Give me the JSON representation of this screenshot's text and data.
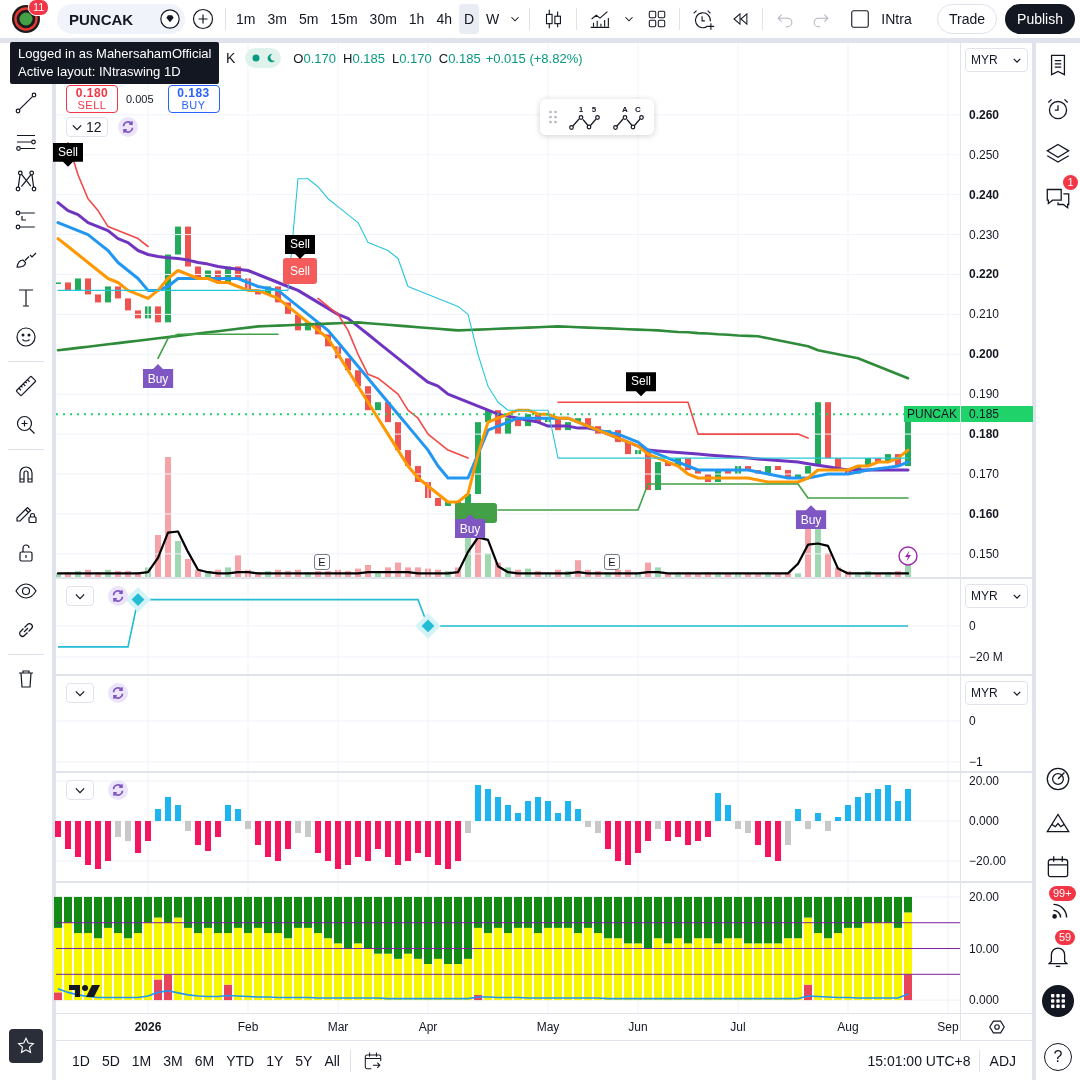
{
  "top_bar": {
    "avatar_badge": "11",
    "symbol": "PUNCAK",
    "intervals": [
      {
        "label": "1m",
        "selected": false
      },
      {
        "label": "3m",
        "selected": false
      },
      {
        "label": "5m",
        "selected": false
      },
      {
        "label": "15m",
        "selected": false
      },
      {
        "label": "30m",
        "selected": false
      },
      {
        "label": "1h",
        "selected": false
      },
      {
        "label": "4h",
        "selected": false
      },
      {
        "label": "D",
        "selected": true
      },
      {
        "label": "W",
        "selected": false
      }
    ],
    "undo": {
      "disabled": true
    },
    "redo": {
      "disabled": true
    },
    "layout_name": "INtra",
    "trade": "Trade",
    "publish": "Publish"
  },
  "tooltip": {
    "lines": [
      "Logged in as MahersahamOfficial",
      "Active layout: INtraswing 1D"
    ]
  },
  "right_sidebar": {
    "chat_badge": "1",
    "feed_badge": "99+",
    "notifications_badge": "59",
    "help": "?"
  },
  "main_pane": {
    "legend": {
      "symbol_tail": "K",
      "values": [
        {
          "key": "O",
          "value": "0.170"
        },
        {
          "key": "H",
          "value": "0.185"
        },
        {
          "key": "L",
          "value": "0.170"
        },
        {
          "key": "C",
          "value": "0.185"
        }
      ],
      "change": "+0.015 (+8.82%)"
    },
    "trade_box": {
      "sell_price": "0.180",
      "sell": "SELL",
      "spread": "0.005",
      "buy_price": "0.183",
      "buy": "BUY"
    },
    "interval_control": "12",
    "currency": "MYR",
    "price_tag": {
      "symbol": "PUNCAK",
      "price": "0.185"
    },
    "signals": [
      {
        "kind": "sell",
        "label": "Sell"
      },
      {
        "kind": "buy",
        "label": "Buy"
      },
      {
        "kind": "sell_box",
        "label": "Sell"
      },
      {
        "kind": "sell",
        "label": "Sell"
      },
      {
        "kind": "earnings",
        "label": "E"
      },
      {
        "kind": "buy_box"
      },
      {
        "kind": "buy",
        "label": "Buy"
      },
      {
        "kind": "earnings",
        "label": "E"
      },
      {
        "kind": "sell",
        "label": "Sell"
      },
      {
        "kind": "buy",
        "label": "Buy"
      },
      {
        "kind": "event"
      }
    ],
    "chart_data": {
      "type": "line",
      "grid": true,
      "ylim": [
        0.1442,
        0.278
      ],
      "yticks": [
        {
          "value": 0.26,
          "label": "0.260"
        },
        {
          "value": 0.25,
          "label": "0.250"
        },
        {
          "value": 0.24,
          "label": "0.240"
        },
        {
          "value": 0.23,
          "label": "0.230"
        },
        {
          "value": 0.22,
          "label": "0.220"
        },
        {
          "value": 0.21,
          "label": "0.210"
        },
        {
          "value": 0.2,
          "label": "0.200"
        },
        {
          "value": 0.19,
          "label": "0.190"
        },
        {
          "value": 0.18,
          "label": "0.180"
        },
        {
          "value": 0.17,
          "label": "0.170"
        },
        {
          "value": 0.16,
          "label": "0.160"
        },
        {
          "value": 0.15,
          "label": "0.150"
        }
      ],
      "ref_lines": [
        {
          "axis": "y",
          "value": 0.185,
          "color": "#1fd26a"
        }
      ],
      "series": [
        {
          "color": "#6f35c0",
          "values": [
            0.238,
            0.236,
            0.235,
            0.233,
            0.232,
            0.231,
            0.229,
            0.228,
            0.226,
            0.225,
            0.2245,
            0.2242,
            0.224,
            0.2236,
            0.223,
            0.2226,
            0.222,
            0.2216,
            0.2213,
            0.221,
            0.22,
            0.219,
            0.218,
            0.217,
            0.216,
            0.2145,
            0.213,
            0.2115,
            0.21,
            0.209,
            0.207,
            0.205,
            0.203,
            0.201,
            0.199,
            0.197,
            0.195,
            0.193,
            0.192,
            0.19,
            0.189,
            0.188,
            0.187,
            0.186,
            0.185,
            0.1845,
            0.184,
            0.1835,
            0.183,
            0.182,
            0.182,
            0.182,
            0.1815,
            0.1815,
            0.181,
            0.18,
            0.179,
            0.178,
            0.177,
            0.176,
            0.1758,
            0.1756,
            0.1754,
            0.1752,
            0.175,
            0.1748,
            0.1746,
            0.1744,
            0.1742,
            0.174,
            0.1738,
            0.1736,
            0.1734,
            0.1732,
            0.173,
            0.1726,
            0.1722,
            0.1718,
            0.1714,
            0.171,
            0.171,
            0.171,
            0.171,
            0.171,
            0.171,
            0.171
          ]
        },
        {
          "color": "#2196f3",
          "values": [
            0.233,
            0.232,
            0.231,
            0.23,
            0.228,
            0.226,
            0.223,
            0.221,
            0.219,
            0.216,
            0.216,
            0.217,
            0.219,
            0.219,
            0.219,
            0.219,
            0.219,
            0.219,
            0.219,
            0.218,
            0.217,
            0.2165,
            0.216,
            0.214,
            0.212,
            0.21,
            0.208,
            0.206,
            0.203,
            0.2,
            0.197,
            0.194,
            0.191,
            0.188,
            0.185,
            0.182,
            0.179,
            0.176,
            0.172,
            0.169,
            0.169,
            0.169,
            0.175,
            0.181,
            0.182,
            0.183,
            0.184,
            0.184,
            0.184,
            0.184,
            0.184,
            0.184,
            0.183,
            0.182,
            0.181,
            0.1805,
            0.18,
            0.179,
            0.178,
            0.176,
            0.175,
            0.174,
            0.173,
            0.172,
            0.171,
            0.171,
            0.171,
            0.171,
            0.171,
            0.171,
            0.1705,
            0.17,
            0.1695,
            0.169,
            0.169,
            0.169,
            0.1695,
            0.17,
            0.17,
            0.17,
            0.1705,
            0.171,
            0.1713,
            0.1716,
            0.172,
            0.173
          ]
        },
        {
          "color": "#ff9800",
          "values": [
            0.229,
            0.227,
            0.225,
            0.223,
            0.221,
            0.219,
            0.218,
            0.216,
            0.215,
            0.214,
            0.216,
            0.219,
            0.221,
            0.22,
            0.219,
            0.219,
            0.218,
            0.218,
            0.217,
            0.216,
            0.216,
            0.215,
            0.214,
            0.212,
            0.21,
            0.208,
            0.206,
            0.204,
            0.2,
            0.196,
            0.192,
            0.188,
            0.184,
            0.18,
            0.176,
            0.172,
            0.169,
            0.167,
            0.165,
            0.163,
            0.163,
            0.165,
            0.175,
            0.183,
            0.184,
            0.185,
            0.186,
            0.186,
            0.185,
            0.185,
            0.184,
            0.184,
            0.183,
            0.182,
            0.181,
            0.18,
            0.179,
            0.178,
            0.177,
            0.175,
            0.174,
            0.173,
            0.172,
            0.17,
            0.169,
            0.169,
            0.169,
            0.169,
            0.169,
            0.169,
            0.1685,
            0.168,
            0.168,
            0.168,
            0.168,
            0.169,
            0.171,
            0.171,
            0.171,
            0.171,
            0.172,
            0.172,
            0.173,
            0.173,
            0.174,
            0.176
          ]
        },
        {
          "color": "#2e8b3a",
          "values": [
            0.201,
            0.2013,
            0.2016,
            0.2019,
            0.2022,
            0.2025,
            0.2028,
            0.2031,
            0.2034,
            0.2037,
            0.204,
            0.2043,
            0.2046,
            0.2049,
            0.2052,
            0.2055,
            0.2058,
            0.2061,
            0.2064,
            0.2067,
            0.207,
            0.2071,
            0.2072,
            0.2073,
            0.2074,
            0.2075,
            0.2076,
            0.2077,
            0.2078,
            0.2079,
            0.208,
            0.2078,
            0.2076,
            0.2074,
            0.2072,
            0.207,
            0.2068,
            0.2066,
            0.2064,
            0.2062,
            0.206,
            0.2061,
            0.2062,
            0.2063,
            0.2064,
            0.2065,
            0.2066,
            0.2067,
            0.2068,
            0.2069,
            0.207,
            0.2069,
            0.2068,
            0.2067,
            0.2066,
            0.2065,
            0.2064,
            0.2063,
            0.2062,
            0.2061,
            0.206,
            0.2058,
            0.2056,
            0.2055,
            0.2053,
            0.2052,
            0.205,
            0.2049,
            0.2047,
            0.2046,
            0.2045,
            0.204,
            0.2035,
            0.203,
            0.2025,
            0.202,
            0.201,
            0.2005,
            0.2,
            0.1995,
            0.199,
            0.198,
            0.197,
            0.196,
            0.195,
            0.194
          ]
        },
        {
          "color": "#f44848",
          "values": [
            null,
            0.253,
            0.245,
            0.239,
            0.236,
            0.232,
            0.231,
            0.23,
            0.229,
            0.227,
            null,
            null,
            null,
            null,
            null,
            null,
            null,
            null,
            null,
            null,
            null,
            null,
            null,
            null,
            null,
            null,
            0.214,
            0.212,
            0.21,
            0.206,
            0.2,
            0.195,
            0.194,
            0.192,
            0.19,
            0.186,
            0.184,
            0.18,
            0.178,
            0.176,
            0.175,
            0.174,
            null,
            null,
            null,
            null,
            null,
            null,
            null,
            null,
            0.188,
            0.188,
            0.188,
            0.188,
            0.188,
            0.188,
            0.188,
            0.188,
            0.188,
            0.188,
            0.188,
            0.188,
            0.188,
            0.188,
            0.18,
            0.18,
            0.18,
            0.18,
            0.18,
            0.18,
            0.18,
            0.18,
            0.18,
            0.18,
            0.18,
            0.179,
            null,
            null,
            null,
            null,
            null,
            null,
            null,
            null,
            null,
            null
          ]
        },
        {
          "color": "#43a047",
          "values": [
            null,
            null,
            null,
            null,
            null,
            null,
            null,
            null,
            null,
            null,
            0.199,
            0.204,
            0.205,
            0.205,
            0.205,
            0.205,
            0.205,
            0.205,
            0.205,
            0.205,
            0.205,
            0.205,
            0.205,
            null,
            null,
            null,
            null,
            null,
            null,
            null,
            null,
            null,
            null,
            null,
            null,
            null,
            null,
            null,
            null,
            null,
            null,
            null,
            null,
            null,
            0.161,
            0.161,
            0.161,
            0.161,
            0.161,
            0.161,
            0.161,
            0.161,
            0.161,
            0.161,
            0.161,
            0.161,
            0.161,
            0.161,
            0.161,
            0.1675,
            0.1675,
            0.1675,
            0.1675,
            0.1675,
            0.1675,
            0.1675,
            0.1675,
            0.1675,
            0.1675,
            0.1675,
            0.1675,
            0.1675,
            0.1675,
            0.1675,
            0.1675,
            0.164,
            0.164,
            0.164,
            0.164,
            0.164,
            0.164,
            0.164,
            0.164,
            0.164,
            0.164,
            0.164
          ]
        },
        {
          "color": "#26c6da",
          "values": [
            0.216,
            0.216,
            0.216,
            0.216,
            0.216,
            0.216,
            0.216,
            0.216,
            0.216,
            0.216,
            0.216,
            0.216,
            0.216,
            0.216,
            0.216,
            0.216,
            0.216,
            0.216,
            0.216,
            0.216,
            0.216,
            0.216,
            0.216,
            0.216,
            0.244,
            0.244,
            0.242,
            0.239,
            0.237,
            0.235,
            0.233,
            0.228,
            0.227,
            0.226,
            0.224,
            0.217,
            0.216,
            0.215,
            0.214,
            0.213,
            0.212,
            0.21,
            0.2,
            0.192,
            0.188,
            0.186,
            0.186,
            0.186,
            0.186,
            0.186,
            0.174,
            0.174,
            0.174,
            0.174,
            0.174,
            0.174,
            0.174,
            0.174,
            0.174,
            0.174,
            0.174,
            0.174,
            0.174,
            0.174,
            0.174,
            0.174,
            0.174,
            0.174,
            0.174,
            0.174,
            0.174,
            0.174,
            0.174,
            0.174,
            0.174,
            0.174,
            0.174,
            0.174,
            0.174,
            0.174,
            0.174,
            0.174,
            0.174,
            0.174,
            0.174,
            0.174
          ]
        },
        {
          "color": "#000000",
          "values": [
            0.1451,
            0.1451,
            0.1451,
            0.1451,
            0.1451,
            0.1451,
            0.1451,
            0.1451,
            0.1451,
            0.1454,
            0.149,
            0.1553,
            0.1556,
            0.1505,
            0.146,
            0.1454,
            0.1451,
            0.1451,
            0.1454,
            0.1454,
            0.1451,
            0.1451,
            0.1451,
            0.1451,
            0.1451,
            0.1451,
            0.1451,
            0.1451,
            0.1451,
            0.1451,
            0.1451,
            0.1454,
            0.1454,
            0.1454,
            0.1454,
            0.1454,
            0.1451,
            0.1451,
            0.1451,
            0.1451,
            0.1454,
            0.1505,
            0.1541,
            0.1535,
            0.1469,
            0.1454,
            0.1451,
            0.1451,
            0.1451,
            0.1451,
            0.1451,
            0.1451,
            0.1454,
            0.1451,
            0.1451,
            0.1451,
            0.1451,
            0.1451,
            0.1451,
            0.1454,
            0.1454,
            0.1451,
            0.1451,
            0.1451,
            0.1451,
            0.1451,
            0.1451,
            0.1451,
            0.1451,
            0.1451,
            0.1451,
            0.1451,
            0.1451,
            0.1451,
            0.1475,
            0.1523,
            0.1526,
            0.152,
            0.1463,
            0.1451,
            0.1451,
            0.1451,
            0.1451,
            0.1451,
            0.1451,
            0.1451
          ]
        }
      ]
    }
  },
  "floating_toolbar": {
    "tools": [
      {
        "marks": [
          "1",
          "5"
        ]
      },
      {
        "marks": [
          "A",
          "C"
        ]
      }
    ]
  },
  "panes": [
    {
      "currency": "MYR",
      "controls_shown": true,
      "chart_data": {
        "type": "line",
        "grid": true,
        "ylim": [
          -31,
          30.3
        ],
        "yticks": [
          {
            "value": 0,
            "label": "0"
          },
          {
            "value": -20,
            "label": "−20 M"
          }
        ],
        "series": [
          {
            "color": "#22bcd4",
            "values": [
              -13.5,
              -13.5,
              -13.5,
              -13.5,
              -13.5,
              -13.5,
              -13.5,
              -13.5,
              17,
              17,
              17,
              17,
              17,
              17,
              17,
              17,
              17,
              17,
              17,
              17,
              17,
              17,
              17,
              17,
              17,
              17,
              17,
              17,
              17,
              17,
              17,
              17,
              17,
              17,
              17,
              17,
              17,
              0,
              0,
              0,
              0,
              0,
              0,
              0,
              0,
              0,
              0,
              0,
              0,
              0,
              0,
              0,
              0,
              0,
              0,
              0,
              0,
              0,
              0,
              0,
              0,
              0,
              0,
              0,
              0,
              0,
              0,
              0,
              0,
              0,
              0,
              0,
              0,
              0,
              0,
              0,
              0,
              0,
              0,
              0,
              0,
              0,
              0,
              0,
              0,
              0
            ]
          },
          {
            "type": "scatter",
            "color": "#22bcd4",
            "values": [
              null,
              null,
              null,
              null,
              null,
              null,
              null,
              null,
              17,
              null,
              null,
              null,
              null,
              null,
              null,
              null,
              null,
              null,
              null,
              null,
              null,
              null,
              null,
              null,
              null,
              null,
              null,
              null,
              null,
              null,
              null,
              null,
              null,
              null,
              null,
              null,
              null,
              0,
              null,
              null,
              null,
              null,
              null,
              null,
              null,
              null,
              null,
              null,
              null,
              null,
              null,
              null,
              null,
              null,
              null,
              null,
              null,
              null,
              null,
              null,
              null,
              null,
              null,
              null,
              null,
              null,
              null,
              null,
              null,
              null,
              null,
              null,
              null,
              null,
              null,
              null,
              null,
              null,
              null,
              null,
              null,
              null,
              null,
              null,
              null,
              null
            ]
          }
        ]
      }
    },
    {
      "currency": "MYR",
      "controls_shown": true,
      "chart_data": {
        "type": "line",
        "grid": true,
        "categories": [
          null,
          null,
          null,
          null,
          null,
          null,
          null,
          null,
          null,
          null,
          null,
          null,
          null,
          null,
          null,
          null,
          null,
          null,
          null,
          null,
          null,
          null,
          null,
          null,
          null,
          null,
          null,
          null,
          null,
          null,
          null,
          null,
          null,
          null,
          null,
          null,
          null,
          null,
          null,
          null,
          null,
          null,
          null,
          null,
          null,
          null,
          null,
          null,
          null,
          null,
          null,
          null,
          null,
          null,
          null,
          null,
          null,
          null,
          null,
          null,
          null,
          null,
          null,
          null,
          null,
          null,
          null,
          null,
          null,
          null,
          null,
          null,
          null,
          null,
          null,
          null,
          null,
          null,
          null,
          null,
          null,
          null,
          null,
          null,
          null,
          null
        ],
        "ylim": [
          -1.22,
          1.1
        ],
        "yticks": [
          {
            "value": 0,
            "label": "0"
          },
          {
            "value": -1,
            "label": "−1"
          }
        ]
      }
    },
    {
      "controls_shown": true,
      "chart_data": {
        "type": "bar",
        "grid": true,
        "ylim": [
          -30,
          24
        ],
        "yticks": [
          {
            "value": 20,
            "label": "20.00"
          },
          {
            "value": 0,
            "label": "0.000"
          },
          {
            "value": -20,
            "label": "−20.00"
          }
        ],
        "series": [
          {
            "color": "#1eb4f0",
            "values": [
              null,
              null,
              null,
              null,
              null,
              null,
              null,
              null,
              null,
              null,
              6,
              12,
              8,
              null,
              null,
              null,
              null,
              8,
              6,
              null,
              null,
              null,
              null,
              null,
              null,
              null,
              null,
              null,
              null,
              null,
              null,
              null,
              null,
              null,
              null,
              null,
              null,
              null,
              null,
              null,
              null,
              null,
              18,
              16,
              12,
              8,
              4,
              10,
              12,
              10,
              4,
              10,
              6,
              null,
              null,
              null,
              null,
              null,
              null,
              null,
              null,
              null,
              null,
              null,
              null,
              null,
              14,
              8,
              null,
              null,
              null,
              null,
              null,
              null,
              6,
              null,
              4,
              null,
              2,
              8,
              12,
              14,
              16,
              18,
              10,
              16
            ]
          },
          {
            "color": "#f5145e",
            "values": [
              -8,
              -14,
              -18,
              -22,
              -24,
              -20,
              null,
              null,
              -16,
              -10,
              null,
              null,
              null,
              null,
              -12,
              -15,
              -8,
              null,
              null,
              null,
              -12,
              -18,
              -20,
              -14,
              null,
              null,
              -16,
              -20,
              -24,
              -22,
              -18,
              -20,
              -14,
              -18,
              -22,
              -20,
              -16,
              -18,
              -22,
              -24,
              -20,
              null,
              null,
              null,
              null,
              null,
              null,
              null,
              null,
              null,
              null,
              null,
              null,
              null,
              null,
              -14,
              -20,
              -22,
              -16,
              -10,
              null,
              -10,
              -8,
              -12,
              -10,
              -8,
              null,
              null,
              null,
              null,
              -12,
              -18,
              -20,
              null,
              null,
              null,
              null,
              null,
              null,
              null,
              null,
              null,
              null,
              null,
              null,
              null
            ]
          },
          {
            "color": "#c8c8c8",
            "values": [
              null,
              null,
              null,
              null,
              null,
              null,
              -8,
              -10,
              null,
              null,
              null,
              null,
              null,
              -5,
              null,
              null,
              null,
              null,
              null,
              -4,
              null,
              null,
              null,
              null,
              -6,
              -8,
              null,
              null,
              null,
              null,
              null,
              null,
              null,
              null,
              null,
              null,
              null,
              null,
              null,
              null,
              null,
              -6,
              null,
              null,
              null,
              null,
              null,
              null,
              null,
              null,
              null,
              null,
              null,
              -3,
              -6,
              null,
              null,
              null,
              null,
              null,
              -4,
              null,
              null,
              null,
              null,
              null,
              null,
              null,
              -4,
              -6,
              null,
              null,
              null,
              -12,
              null,
              -4,
              null,
              -5,
              null,
              null,
              null,
              null,
              null,
              null,
              null,
              null
            ]
          }
        ]
      }
    },
    {
      "controls_shown": false,
      "chart_data": {
        "type": "bar",
        "stacked": true,
        "grid": true,
        "categories": [
          null,
          null,
          null,
          null,
          null,
          null,
          null,
          null,
          null,
          "2026",
          null,
          null,
          null,
          null,
          null,
          null,
          null,
          null,
          null,
          "Feb",
          null,
          null,
          null,
          null,
          null,
          null,
          null,
          null,
          "Mar",
          null,
          null,
          null,
          null,
          null,
          null,
          null,
          null,
          "Apr",
          null,
          null,
          null,
          null,
          null,
          null,
          null,
          null,
          null,
          null,
          null,
          "May",
          null,
          null,
          null,
          null,
          null,
          null,
          null,
          null,
          "Jun",
          null,
          null,
          null,
          null,
          null,
          null,
          null,
          null,
          null,
          "Jul",
          null,
          null,
          null,
          null,
          null,
          null,
          null,
          null,
          null,
          null,
          "Aug",
          null,
          null,
          null,
          null,
          null,
          null,
          null,
          null,
          null,
          "Sep"
        ],
        "ylim": [
          -2.5,
          22.7
        ],
        "yticks": [
          {
            "value": 20,
            "label": "20.00"
          },
          {
            "value": 10,
            "label": "10.00"
          },
          {
            "value": 0,
            "label": "0.000"
          }
        ],
        "ref_lines": [
          {
            "axis": "y",
            "value": 15,
            "color": "#7b1fa2"
          },
          {
            "axis": "y",
            "value": 10,
            "color": "#7b1fa2"
          },
          {
            "axis": "y",
            "value": 5,
            "color": "#7b1fa2"
          }
        ],
        "series": [
          {
            "color": "#e8445a",
            "values": [
              1.5,
              null,
              null,
              null,
              null,
              null,
              null,
              null,
              null,
              null,
              4,
              5,
              null,
              null,
              null,
              null,
              null,
              3,
              null,
              null,
              null,
              null,
              null,
              null,
              null,
              null,
              null,
              null,
              null,
              null,
              null,
              null,
              null,
              null,
              null,
              null,
              null,
              null,
              null,
              null,
              null,
              null,
              1,
              null,
              null,
              null,
              null,
              null,
              null,
              null,
              null,
              null,
              null,
              null,
              null,
              null,
              null,
              null,
              null,
              null,
              null,
              null,
              null,
              null,
              null,
              null,
              null,
              null,
              null,
              null,
              null,
              null,
              null,
              null,
              null,
              3,
              null,
              null,
              null,
              null,
              null,
              null,
              null,
              null,
              null,
              5,
              null,
              null,
              null,
              null
            ]
          },
          {
            "color": "#f7f700",
            "values": [
              12.5,
              15,
              13,
              13,
              12,
              14,
              13,
              12,
              13,
              15,
              12,
              10,
              16,
              14,
              13,
              14,
              13,
              10,
              14,
              13,
              14,
              13,
              13,
              12,
              14,
              14,
              13,
              12,
              11,
              10,
              11,
              10,
              9,
              9,
              8,
              9,
              8,
              7,
              8,
              7,
              7,
              8,
              13,
              13,
              14,
              13,
              14,
              14,
              13,
              14,
              14,
              14,
              13,
              14,
              13,
              12,
              12,
              11,
              11,
              10,
              12,
              11,
              12,
              11,
              12,
              12,
              11,
              12,
              12,
              11,
              11,
              11,
              11,
              12,
              12,
              13,
              13,
              12,
              13,
              14,
              14,
              15,
              15,
              15,
              14,
              12,
              null,
              null,
              null,
              null
            ]
          },
          {
            "color": "#138a13",
            "values": [
              6,
              5,
              7,
              7,
              8,
              6,
              7,
              8,
              7,
              5,
              4,
              5,
              4,
              6,
              7,
              6,
              7,
              7,
              6,
              7,
              6,
              7,
              7,
              8,
              6,
              6,
              7,
              8,
              9,
              10,
              9,
              10,
              11,
              11,
              12,
              11,
              12,
              13,
              12,
              13,
              13,
              12,
              6,
              7,
              6,
              7,
              6,
              6,
              7,
              6,
              6,
              6,
              7,
              6,
              7,
              8,
              8,
              9,
              9,
              10,
              8,
              9,
              8,
              9,
              8,
              8,
              9,
              8,
              8,
              9,
              9,
              9,
              9,
              8,
              8,
              4,
              7,
              8,
              7,
              6,
              6,
              5,
              5,
              5,
              6,
              3,
              null,
              null,
              null,
              null
            ]
          },
          {
            "type": "line",
            "color": "#2196f3",
            "values": [
              2.2,
              1.5,
              1,
              0.7,
              0.5,
              0.5,
              0.5,
              0.5,
              0.5,
              0.8,
              1.5,
              1.8,
              1.4,
              1,
              0.8,
              0.7,
              0.7,
              0.9,
              0.8,
              0.7,
              0.6,
              0.6,
              0.5,
              0.5,
              0.5,
              0.5,
              0.4,
              0.4,
              0.4,
              0.4,
              0.4,
              0.4,
              0.4,
              0.3,
              0.3,
              0.3,
              0.3,
              0.3,
              0.3,
              0.3,
              0.3,
              0.3,
              0.6,
              0.6,
              0.5,
              0.5,
              0.5,
              0.4,
              0.4,
              0.4,
              0.4,
              0.4,
              0.4,
              0.4,
              0.4,
              0.3,
              0.3,
              0.3,
              0.3,
              0.3,
              0.3,
              0.3,
              0.3,
              0.3,
              0.3,
              0.3,
              0.3,
              0.3,
              0.3,
              0.3,
              0.3,
              0.3,
              0.3,
              0.3,
              0.3,
              0.8,
              0.7,
              0.6,
              0.5,
              0.5,
              0.4,
              0.4,
              0.4,
              0.4,
              0.4,
              1.2,
              null,
              null,
              null,
              null
            ]
          }
        ]
      }
    }
  ],
  "range_bar": {
    "ranges": [
      "1D",
      "5D",
      "1M",
      "3M",
      "6M",
      "YTD",
      "1Y",
      "5Y",
      "All"
    ],
    "clock": "15:01:00 UTC+8",
    "adjust": "ADJ"
  }
}
